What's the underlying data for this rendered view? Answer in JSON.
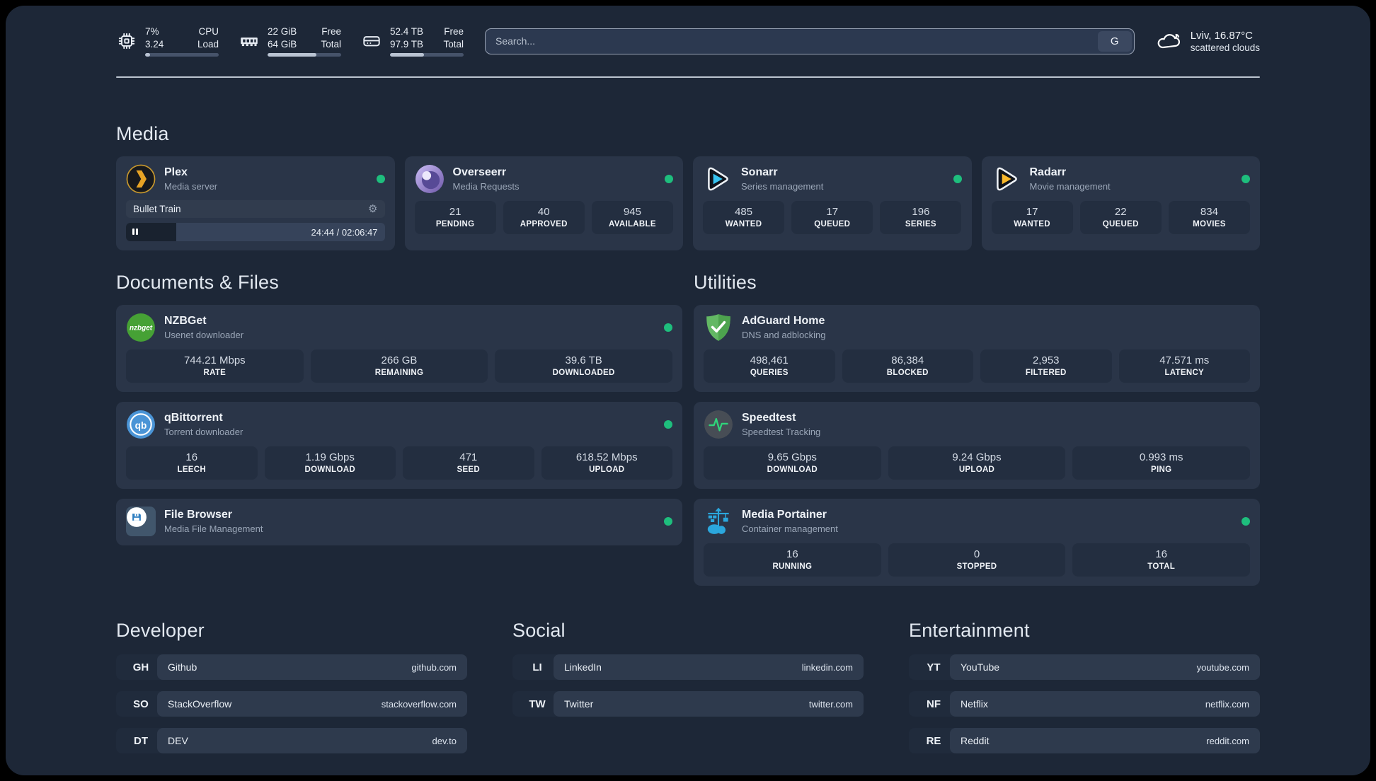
{
  "colors": {
    "status_online": "#1ebe7d"
  },
  "system": {
    "metrics": [
      {
        "id": "cpu",
        "icon": "cpu-icon",
        "col1": [
          "7%",
          "3.24"
        ],
        "col2": [
          "CPU",
          "Load"
        ],
        "progress_pct": 7
      },
      {
        "id": "ram",
        "icon": "ram-icon",
        "col1": [
          "22 GiB",
          "64 GiB"
        ],
        "col2": [
          "Free",
          "Total"
        ],
        "progress_pct": 66
      },
      {
        "id": "disk",
        "icon": "disk-icon",
        "col1": [
          "52.4 TB",
          "97.9 TB"
        ],
        "col2": [
          "Free",
          "Total"
        ],
        "progress_pct": 46
      }
    ]
  },
  "search": {
    "placeholder": "Search...",
    "button_label": "G"
  },
  "weather": {
    "icon": "cloud-icon",
    "location": "Lviv, 16.87°C",
    "condition": "scattered clouds"
  },
  "sections": {
    "media": {
      "title": "Media",
      "services": [
        {
          "name": "Plex",
          "description": "Media server",
          "icon": "plex-icon",
          "status": "online",
          "media_player": {
            "now_playing": "Bullet Train",
            "state": "paused",
            "time_display": "24:44 / 02:06:47",
            "elapsed": "24:44",
            "duration": "02:06:47",
            "progress_pct": 19.5
          }
        },
        {
          "name": "Overseerr",
          "description": "Media Requests",
          "icon": "overseerr-icon",
          "status": "online",
          "stats": [
            {
              "value": "21",
              "label": "PENDING"
            },
            {
              "value": "40",
              "label": "APPROVED"
            },
            {
              "value": "945",
              "label": "AVAILABLE"
            }
          ]
        },
        {
          "name": "Sonarr",
          "description": "Series management",
          "icon": "sonarr-icon",
          "status": "online",
          "stats": [
            {
              "value": "485",
              "label": "WANTED"
            },
            {
              "value": "17",
              "label": "QUEUED"
            },
            {
              "value": "196",
              "label": "SERIES"
            }
          ]
        },
        {
          "name": "Radarr",
          "description": "Movie management",
          "icon": "radarr-icon",
          "status": "online",
          "stats": [
            {
              "value": "17",
              "label": "WANTED"
            },
            {
              "value": "22",
              "label": "QUEUED"
            },
            {
              "value": "834",
              "label": "MOVIES"
            }
          ]
        }
      ]
    },
    "documents": {
      "title": "Documents & Files",
      "services": [
        {
          "name": "NZBGet",
          "description": "Usenet downloader",
          "icon": "nzbget-icon",
          "status": "online",
          "stats": [
            {
              "value": "744.21 Mbps",
              "label": "RATE"
            },
            {
              "value": "266 GB",
              "label": "REMAINING"
            },
            {
              "value": "39.6 TB",
              "label": "DOWNLOADED"
            }
          ]
        },
        {
          "name": "qBittorrent",
          "description": "Torrent downloader",
          "icon": "qbittorrent-icon",
          "status": "online",
          "stats": [
            {
              "value": "16",
              "label": "LEECH"
            },
            {
              "value": "1.19 Gbps",
              "label": "DOWNLOAD"
            },
            {
              "value": "471",
              "label": "SEED"
            },
            {
              "value": "618.52 Mbps",
              "label": "UPLOAD"
            }
          ]
        },
        {
          "name": "File Browser",
          "description": "Media File Management",
          "icon": "filebrowser-icon",
          "status": "online"
        }
      ]
    },
    "utilities": {
      "title": "Utilities",
      "services": [
        {
          "name": "AdGuard Home",
          "description": "DNS and adblocking",
          "icon": "adguard-icon",
          "status": "",
          "stats": [
            {
              "value": "498,461",
              "label": "QUERIES"
            },
            {
              "value": "86,384",
              "label": "BLOCKED"
            },
            {
              "value": "2,953",
              "label": "FILTERED"
            },
            {
              "value": "47.571 ms",
              "label": "LATENCY"
            }
          ]
        },
        {
          "name": "Speedtest",
          "description": "Speedtest Tracking",
          "icon": "speedtest-icon",
          "status": "",
          "stats": [
            {
              "value": "9.65 Gbps",
              "label": "DOWNLOAD"
            },
            {
              "value": "9.24 Gbps",
              "label": "UPLOAD"
            },
            {
              "value": "0.993 ms",
              "label": "PING"
            }
          ]
        },
        {
          "name": "Media Portainer",
          "description": "Container management",
          "icon": "portainer-icon",
          "status": "online",
          "stats": [
            {
              "value": "16",
              "label": "RUNNING"
            },
            {
              "value": "0",
              "label": "STOPPED"
            },
            {
              "value": "16",
              "label": "TOTAL"
            }
          ]
        }
      ]
    }
  },
  "link_groups": [
    {
      "title": "Developer",
      "links": [
        {
          "abbr": "GH",
          "name": "Github",
          "url": "github.com"
        },
        {
          "abbr": "SO",
          "name": "StackOverflow",
          "url": "stackoverflow.com"
        },
        {
          "abbr": "DT",
          "name": "DEV",
          "url": "dev.to"
        }
      ]
    },
    {
      "title": "Social",
      "links": [
        {
          "abbr": "LI",
          "name": "LinkedIn",
          "url": "linkedin.com"
        },
        {
          "abbr": "TW",
          "name": "Twitter",
          "url": "twitter.com"
        }
      ]
    },
    {
      "title": "Entertainment",
      "links": [
        {
          "abbr": "YT",
          "name": "YouTube",
          "url": "youtube.com"
        },
        {
          "abbr": "NF",
          "name": "Netflix",
          "url": "netflix.com"
        },
        {
          "abbr": "RE",
          "name": "Reddit",
          "url": "reddit.com"
        }
      ]
    }
  ]
}
